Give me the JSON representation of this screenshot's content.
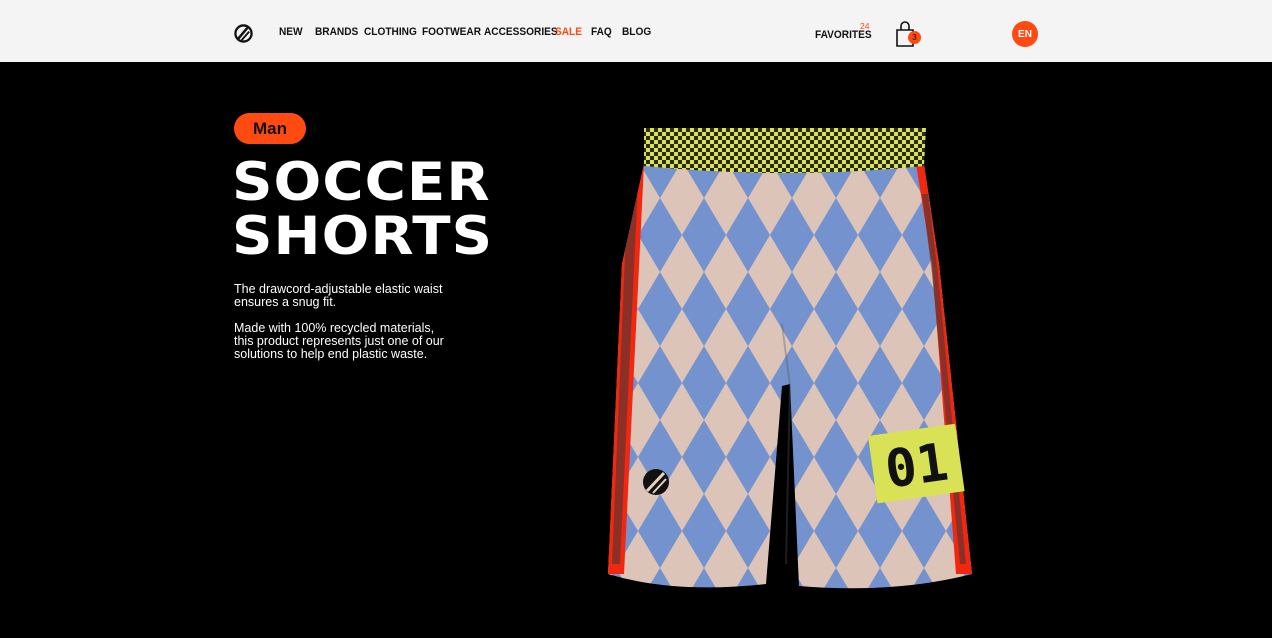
{
  "header": {
    "nav": [
      "NEW",
      "BRANDS",
      "CLOTHING",
      "FOOTWEAR",
      "ACCESSORIES",
      "SALE",
      "FAQ",
      "BLOG"
    ],
    "favorites_label": "FAVORITES",
    "favorites_count": "24",
    "cart_count": "3",
    "language": "EN",
    "accent": "#ff4a12"
  },
  "hero": {
    "tag": "Man",
    "title_line1": "SOCCER",
    "title_line2": "SHORTS",
    "desc1": "The drawcord-adjustable elastic waist ensures a snug fit.",
    "desc2": "Made with 100% recycled materials, this product represents just one of our solutions to help end plastic waste.",
    "product_number": "01"
  }
}
